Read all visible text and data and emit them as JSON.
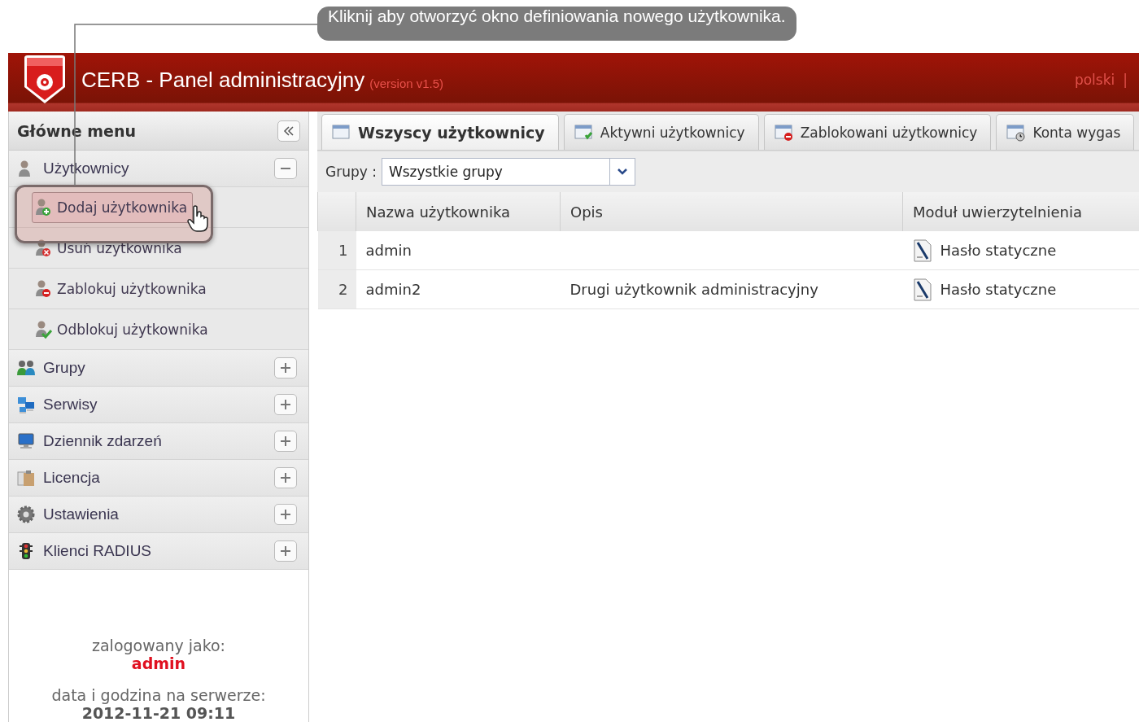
{
  "callout": {
    "text": "Kliknij aby otworzyć okno definiowania nowego użytkownika."
  },
  "header": {
    "title": "CERB - Panel administracyjny",
    "version": "(version v1.5)",
    "language": "polski",
    "separator": "|"
  },
  "sidebar": {
    "title": "Główne menu",
    "items": [
      {
        "label": "Użytkownicy",
        "expanded": true,
        "children": [
          {
            "label": "Dodaj użytkownika",
            "highlighted": true
          },
          {
            "label": "Usuń użytkownika",
            "highlighted": false
          },
          {
            "label": "Zablokuj użytkownika",
            "highlighted": false
          },
          {
            "label": "Odblokuj użytkownika",
            "highlighted": false
          }
        ]
      },
      {
        "label": "Grupy",
        "expanded": false
      },
      {
        "label": "Serwisy",
        "expanded": false
      },
      {
        "label": "Dziennik zdarzeń",
        "expanded": false
      },
      {
        "label": "Licencja",
        "expanded": false
      },
      {
        "label": "Ustawienia",
        "expanded": false
      },
      {
        "label": "Klienci RADIUS",
        "expanded": false
      }
    ],
    "login_label": "zalogowany jako:",
    "user": "admin",
    "time_label": "data i godzina na serwerze:",
    "time": "2012-11-21 09:11"
  },
  "tabs": [
    {
      "label": "Wszyscy użytkownicy",
      "selected": true
    },
    {
      "label": "Aktywni użytkownicy",
      "selected": false
    },
    {
      "label": "Zablokowani użytkownicy",
      "selected": false
    },
    {
      "label": "Konta wygas",
      "selected": false
    }
  ],
  "filter": {
    "label": "Grupy :",
    "value": "Wszystkie grupy"
  },
  "table": {
    "columns": [
      "Nazwa użytkownika",
      "Opis",
      "Moduł uwierzytelnienia"
    ],
    "rows": [
      {
        "number": "1",
        "name": "admin",
        "auth": "Hasło statyczne"
      },
      {
        "number": "2",
        "name": "admin2",
        "description": "Drugi użytkownik administracyjny",
        "auth": "Hasło statyczne"
      }
    ]
  }
}
